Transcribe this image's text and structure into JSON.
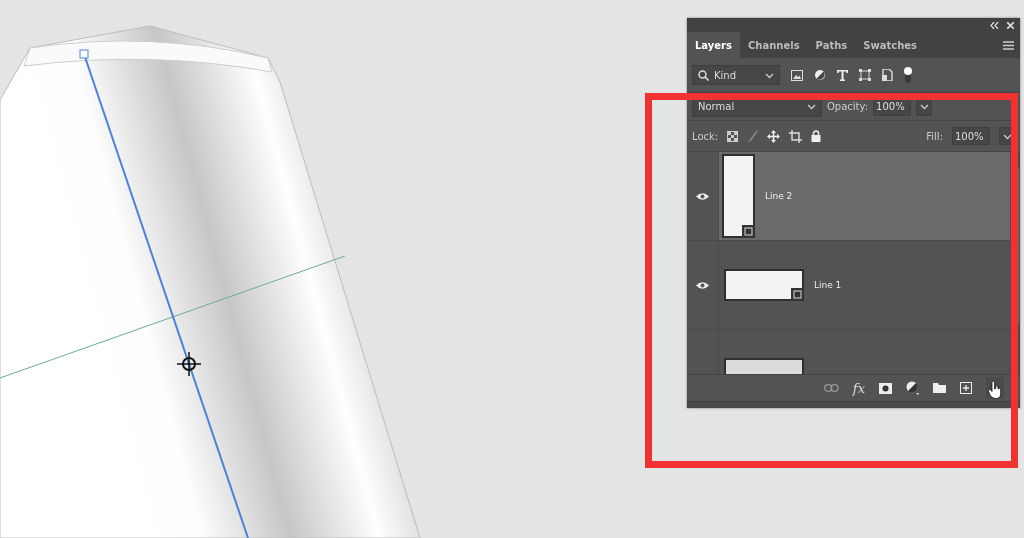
{
  "panel": {
    "tabs": [
      {
        "label": "Layers",
        "selected": true
      },
      {
        "label": "Channels",
        "selected": false
      },
      {
        "label": "Paths",
        "selected": false
      },
      {
        "label": "Swatches",
        "selected": false
      }
    ],
    "filter": {
      "value": "Kind"
    },
    "blend_mode": {
      "value": "Normal"
    },
    "opacity": {
      "label": "Opacity:",
      "value": "100%"
    },
    "lock": {
      "label": "Lock:"
    },
    "fill": {
      "label": "Fill:",
      "value": "100%"
    },
    "layers": [
      {
        "name": "Line 2",
        "kind": "tall",
        "visible": true,
        "selected": true
      },
      {
        "name": "Line 1",
        "kind": "wide",
        "visible": true,
        "selected": false
      },
      {
        "kind": "image",
        "selected": false
      }
    ],
    "layer_style": {
      "label": "fx"
    }
  }
}
